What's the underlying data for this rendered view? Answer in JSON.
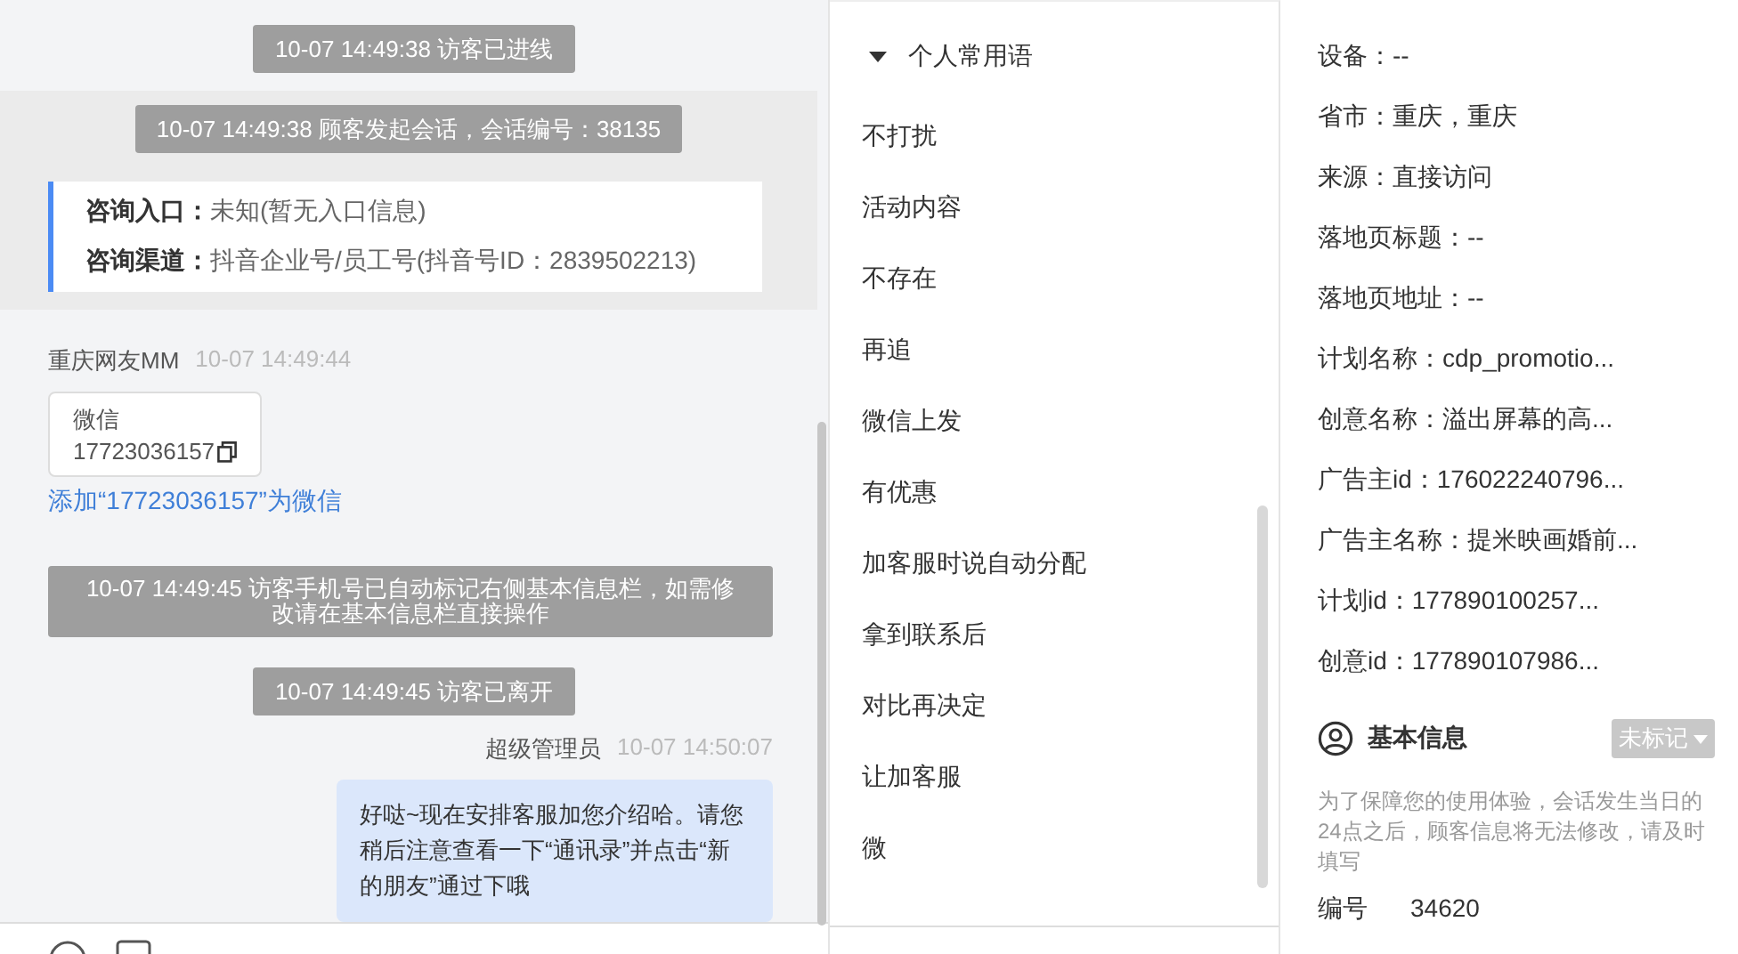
{
  "chat": {
    "messages": [
      {
        "kind": "notice",
        "text": "10-07 14:49:38 访客已进线"
      },
      {
        "kind": "session",
        "text": "10-07 14:49:38 顾客发起会话，会话编号：38135",
        "fields": [
          {
            "label": "咨询入口：",
            "value": "未知(暂无入口信息)"
          },
          {
            "label": "咨询渠道：",
            "value": "抖音企业号/员工号(抖音号ID：2839502213)"
          }
        ]
      },
      {
        "kind": "visitor",
        "sender": "重庆网友MM",
        "time": "10-07 14:49:44",
        "card_title": "微信",
        "card_number": "17723036157",
        "link": "添加“17723036157”为微信"
      },
      {
        "kind": "notice",
        "text": "10-07 14:49:45 访客手机号已自动标记右侧基本信息栏，如需修改请在基本信息栏直接操作"
      },
      {
        "kind": "notice",
        "text": "10-07 14:49:45 访客已离开"
      },
      {
        "kind": "agent",
        "sender": "超级管理员",
        "time": "10-07 14:50:07",
        "text": "好哒~现在安排客服加您介绍哈。请您稍后注意查看一下“通讯录”并点击“新的朋友”通过下哦"
      }
    ]
  },
  "phrases": {
    "group": {
      "title": "个人常用语",
      "expanded": true
    },
    "items": [
      "不打扰",
      "活动内容",
      "不存在",
      "再追",
      "微信上发",
      "有优惠",
      "加客服时说自动分配",
      "拿到联系后",
      "对比再决定",
      "让加客服",
      "微"
    ]
  },
  "details": {
    "rows": [
      "设备：--",
      "省市：重庆，重庆",
      "来源：直接访问",
      "落地页标题：--",
      "落地页地址：--",
      "计划名称：cdp_promotio...",
      "创意名称：溢出屏幕的高...",
      "广告主id：176022240796...",
      "广告主名称：提米映画婚前...",
      "计划id：177890100257...",
      "创意id：177890107986..."
    ],
    "basic_info": {
      "title": "基本信息",
      "mark": "未标记",
      "hint": "为了保障您的使用体验，会话发生当日的24点之后，顾客信息将无法修改，请及时填写",
      "fields": [
        {
          "label": "编号",
          "value": "34620"
        }
      ]
    }
  }
}
